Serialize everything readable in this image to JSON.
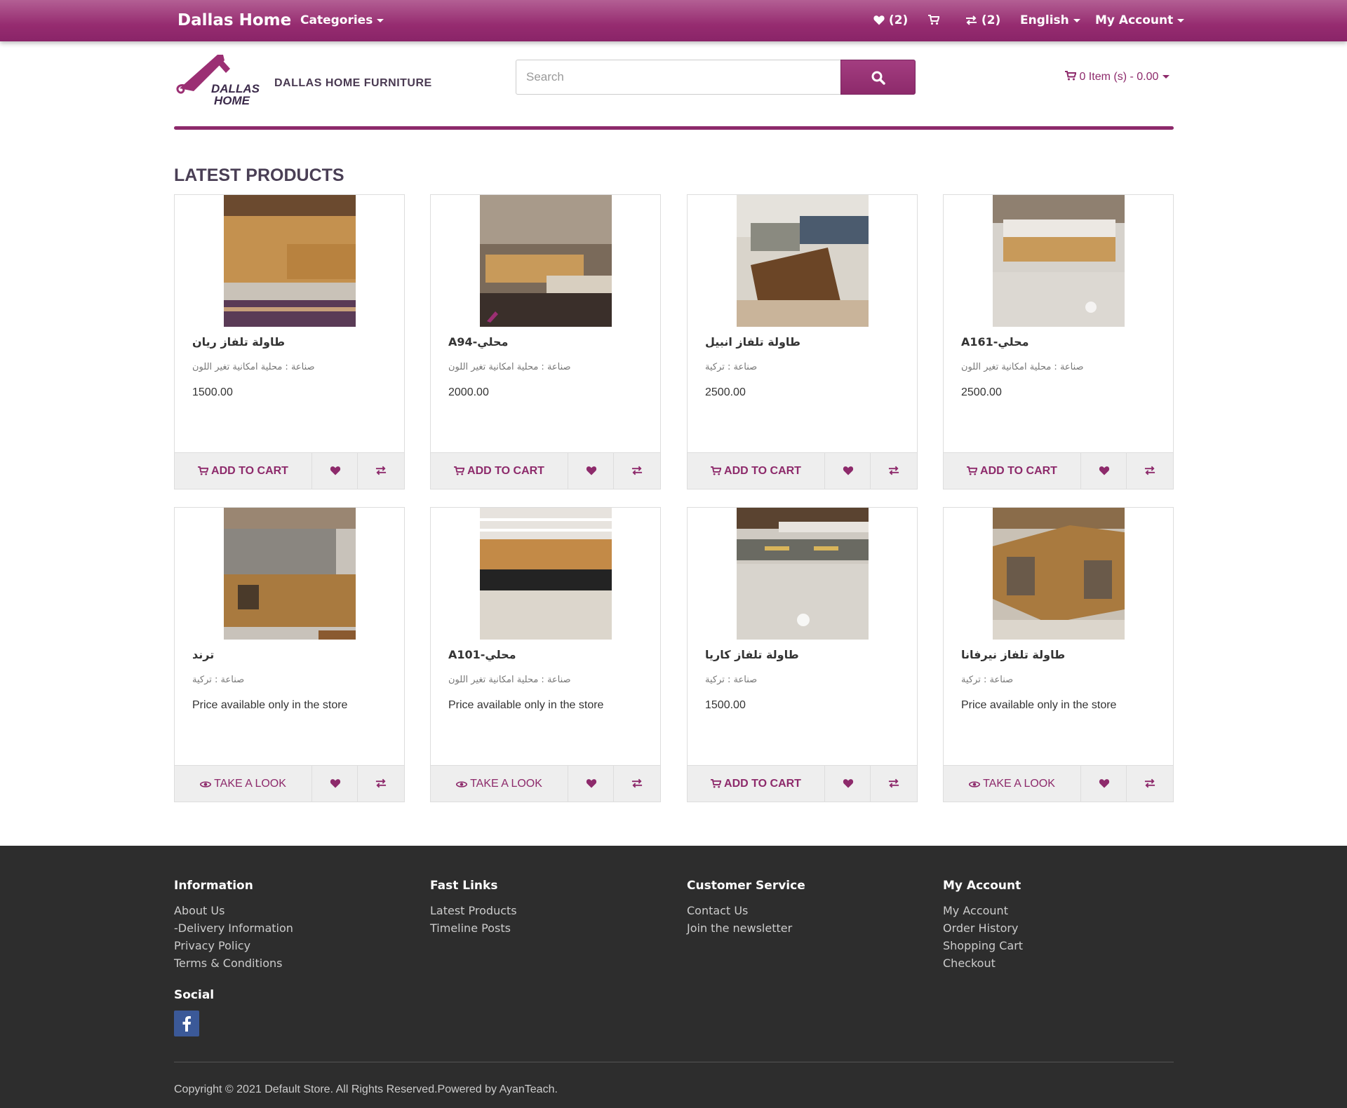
{
  "navbar": {
    "brand": "Dallas Home",
    "categories_label": "Categories",
    "wishlist_count": "(2)",
    "compare_count": "(2)",
    "language": "English",
    "account_label": "My Account"
  },
  "header": {
    "logo_text": "DALLAS HOME",
    "company_name": "DALLAS HOME FURNITURE",
    "search": {
      "placeholder": "Search"
    },
    "cart_summary": "0 Item (s) - 0.00"
  },
  "section_title": "LATEST PRODUCTS",
  "products": [
    {
      "name": "طاولة تلفاز ريان",
      "desc": "صناعة : محلية امكانية تغير اللون",
      "price": "1500.00",
      "action": "ADD TO CART",
      "action_type": "cart"
    },
    {
      "name": "محلي-A94",
      "desc": "صناعة : محلية امكانية تغير اللون",
      "price": "2000.00",
      "action": "ADD TO CART",
      "action_type": "cart"
    },
    {
      "name": "طاولة تلفاز انبيل",
      "desc": "صناعة : تركية",
      "price": "2500.00",
      "action": "ADD TO CART",
      "action_type": "cart"
    },
    {
      "name": "محلي-A161",
      "desc": "صناعة : محلية امكانية تغير اللون",
      "price": "2500.00",
      "action": "ADD TO CART",
      "action_type": "cart"
    },
    {
      "name": "ترند",
      "desc": "صناعة : تركية",
      "price": "Price available only in the store",
      "action": "TAKE A LOOK",
      "action_type": "look"
    },
    {
      "name": "محلي-A101",
      "desc": "صناعة : محلية امكانية تغير اللون",
      "price": "Price available only in the store",
      "action": "TAKE A LOOK",
      "action_type": "look"
    },
    {
      "name": "طاولة تلفاز كاريا",
      "desc": "صناعة : تركية",
      "price": "1500.00",
      "action": "ADD TO CART",
      "action_type": "cart"
    },
    {
      "name": "طاولة تلفاز نيرفانا",
      "desc": "صناعة : تركية",
      "price": "Price available only in the store",
      "action": "TAKE A LOOK",
      "action_type": "look"
    }
  ],
  "footer": {
    "information": {
      "title": "Information",
      "links": [
        "About Us",
        "-Delivery Information",
        "Privacy Policy",
        "Terms & Conditions"
      ]
    },
    "fast_links": {
      "title": "Fast Links",
      "links": [
        "Latest Products",
        "Timeline Posts"
      ]
    },
    "customer_service": {
      "title": "Customer Service",
      "links": [
        "Contact Us",
        "Join the newsletter"
      ]
    },
    "my_account": {
      "title": "My Account",
      "links": [
        "My Account",
        "Order History",
        "Shopping Cart",
        "Checkout"
      ]
    },
    "social_title": "Social",
    "copyright": "Copyright © 2021 Default Store. All Rights Reserved.Powered by AyanTeach."
  },
  "colors": {
    "brand": "#8d2a6b",
    "footer_bg": "#2d2d2d",
    "social_facebook": "#3b5998"
  }
}
